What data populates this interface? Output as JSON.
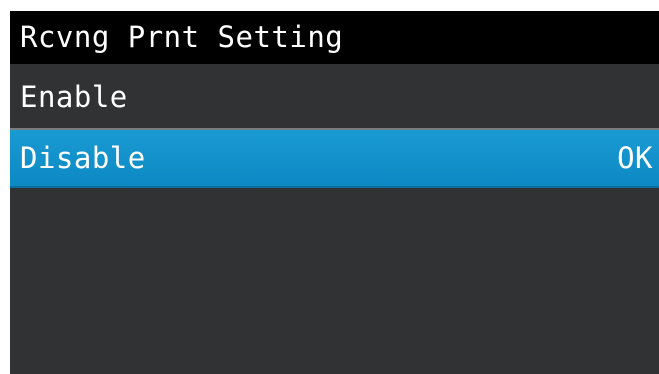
{
  "screen": {
    "title": "Rcvng Prnt Setting"
  },
  "menu": {
    "items": [
      {
        "label": "Enable",
        "selected": false
      },
      {
        "label": "Disable",
        "selected": true,
        "status": "OK"
      }
    ]
  },
  "colors": {
    "title_bg": "#000000",
    "screen_bg": "#303234",
    "selected_bg": "#1090cc",
    "text": "#ffffff"
  }
}
